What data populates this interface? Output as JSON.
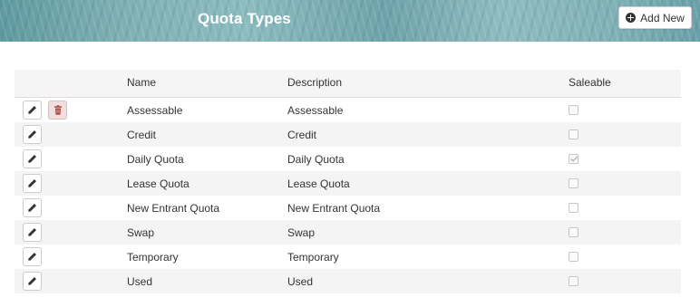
{
  "header": {
    "title": "Quota Types",
    "add_button_label": "Add New"
  },
  "table": {
    "columns": [
      "Name",
      "Description",
      "Saleable"
    ],
    "rows": [
      {
        "name": "Assessable",
        "description": "Assessable",
        "saleable": false,
        "deletable": true
      },
      {
        "name": "Credit",
        "description": "Credit",
        "saleable": false,
        "deletable": false
      },
      {
        "name": "Daily Quota",
        "description": "Daily Quota",
        "saleable": true,
        "deletable": false
      },
      {
        "name": "Lease Quota",
        "description": "Lease Quota",
        "saleable": false,
        "deletable": false
      },
      {
        "name": "New Entrant Quota",
        "description": "New Entrant Quota",
        "saleable": false,
        "deletable": false
      },
      {
        "name": "Swap",
        "description": "Swap",
        "saleable": false,
        "deletable": false
      },
      {
        "name": "Temporary",
        "description": "Temporary",
        "saleable": false,
        "deletable": false
      },
      {
        "name": "Used",
        "description": "Used",
        "saleable": false,
        "deletable": false
      }
    ]
  },
  "icons": {
    "edit": "pencil-icon",
    "delete": "trash-icon",
    "add": "plus-circle-icon"
  },
  "colors": {
    "delete_button_bg": "#f2dede",
    "delete_icon": "#a94442"
  }
}
